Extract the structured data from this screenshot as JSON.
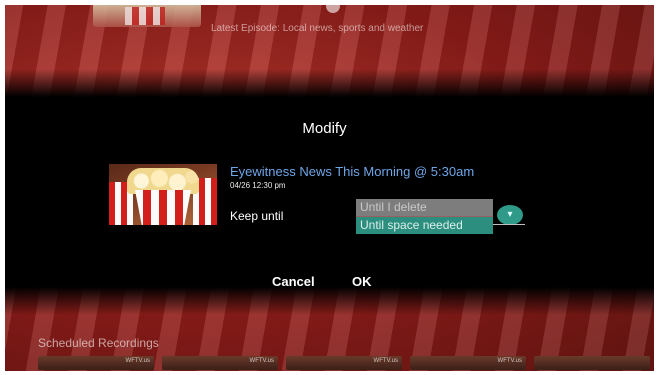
{
  "background": {
    "top_subtitle": "Latest Episode: Local news, sports and weather",
    "section_title": "Scheduled Recordings",
    "card_labels": [
      "WFTV.us",
      "WFTV.us",
      "WFTV.us",
      "WFTV.us",
      ""
    ]
  },
  "dialog": {
    "title": "Modify",
    "program_title": "Eyewitness News This Morning @ 5:30am",
    "program_datetime": "04/26  12:30 pm",
    "keep_label": "Keep until",
    "keep_options": [
      "Until I delete",
      "Until space needed"
    ],
    "keep_selected": "Until space needed",
    "cancel_label": "Cancel",
    "ok_label": "OK"
  },
  "colors": {
    "accent": "#2b8e7f",
    "title_link": "#6ea6e8"
  }
}
